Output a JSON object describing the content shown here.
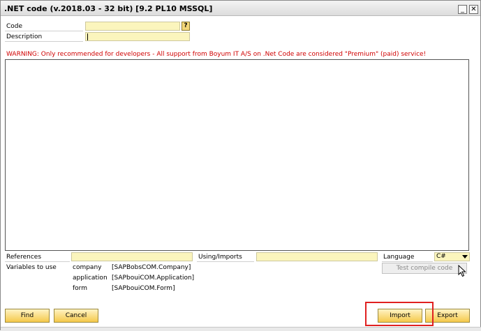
{
  "window": {
    "title": ".NET code (v.2018.03 - 32 bit) [9.2 PL10 MSSQL]",
    "minimize_glyph": "_",
    "close_glyph": "✕"
  },
  "form": {
    "code_label": "Code",
    "code_value": "",
    "lookup_glyph": "?",
    "description_label": "Description",
    "description_value": ""
  },
  "warning": "WARNING: Only recommended for developers - All support from Boyum IT A/S on .Net Code are considered \"Premium\" (paid) service!",
  "editor": {
    "content": ""
  },
  "references": {
    "label": "References",
    "value": "",
    "using_label": "Using/Imports",
    "using_value": "",
    "language_label": "Language",
    "language_value": "C#"
  },
  "variables": {
    "label": "Variables to use",
    "items": [
      {
        "name": "company",
        "type": "[SAPBobsCOM.Company]"
      },
      {
        "name": "application",
        "type": "[SAPbouiCOM.Application]"
      },
      {
        "name": "form",
        "type": "[SAPbouiCOM.Form]"
      }
    ]
  },
  "buttons": {
    "test_compile": "Test compile code",
    "find": "Find",
    "cancel": "Cancel",
    "import": "Import",
    "export": "Export"
  },
  "colors": {
    "warning": "#d00000",
    "field_bg": "#fbf5bd",
    "highlight": "#e02020"
  }
}
